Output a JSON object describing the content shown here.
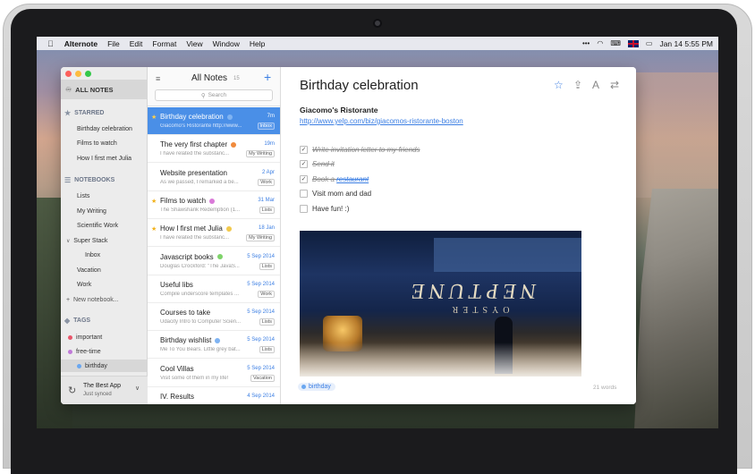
{
  "menubar": {
    "apple": "",
    "app_name": "Alternote",
    "menus": [
      "File",
      "Edit",
      "Format",
      "View",
      "Window",
      "Help"
    ],
    "date_time": "Jan 14  5:55 PM"
  },
  "sidebar": {
    "all_notes": "ALL NOTES",
    "starred_header": "STARRED",
    "starred": [
      "Birthday celebration",
      "Films to watch",
      "How I first met Julia"
    ],
    "notebooks_header": "NOTEBOOKS",
    "notebooks": [
      "Lists",
      "My Writing",
      "Scientific Work",
      "Super Stack"
    ],
    "stack_children": [
      "Inbox"
    ],
    "notebooks_after": [
      "Vacation",
      "Work"
    ],
    "new_notebook": "New notebook...",
    "tags_header": "TAGS",
    "tags": [
      {
        "name": "important",
        "color": "#e8566b"
      },
      {
        "name": "free-time",
        "color": "#c07ad8"
      },
      {
        "name": "birthday",
        "color": "#6aa7f0"
      }
    ],
    "sync": {
      "title": "The Best App",
      "subtitle": "Just synced"
    }
  },
  "notelist": {
    "title": "All Notes",
    "count": "15",
    "search_placeholder": "Search",
    "notes": [
      {
        "title": "Birthday celebration",
        "starred": true,
        "dot": "#7fb3f2",
        "date": "7m",
        "snippet": "Giacomo's Ristorante http://www...",
        "notebook": "Inbox",
        "selected": true
      },
      {
        "title": "The very first chapter",
        "starred": false,
        "dot": "#f08a3c",
        "date": "19m",
        "snippet": "I have related the substanc...",
        "notebook": "My Writing",
        "selected": false
      },
      {
        "title": "Website presentation",
        "starred": false,
        "dot": "",
        "date": "2 Apr",
        "snippet": "As we passed, I remarked a be...",
        "notebook": "Work",
        "selected": false
      },
      {
        "title": "Films to watch",
        "starred": true,
        "dot": "#d97ad8",
        "date": "31 Mar",
        "snippet": "The Shawshank Redemption (1...",
        "notebook": "Lists",
        "selected": false
      },
      {
        "title": "How I first met Julia",
        "starred": true,
        "dot": "#f2c94c",
        "date": "18 Jan",
        "snippet": "I have related the substanc...",
        "notebook": "My Writing",
        "selected": false
      },
      {
        "title": "Javascript books",
        "starred": false,
        "dot": "#7ed36a",
        "date": "5 Sep 2014",
        "snippet": "Douglas Crockford: \"The JavaS...",
        "notebook": "Lists",
        "selected": false
      },
      {
        "title": "Useful libs",
        "starred": false,
        "dot": "",
        "date": "5 Sep 2014",
        "snippet": "Compile underscore templates ...",
        "notebook": "Work",
        "selected": false
      },
      {
        "title": "Courses to take",
        "starred": false,
        "dot": "",
        "date": "5 Sep 2014",
        "snippet": "Udacity Intro to Computer Scien...",
        "notebook": "Lists",
        "selected": false
      },
      {
        "title": "Birthday wishlist",
        "starred": false,
        "dot": "#7fb3f2",
        "date": "5 Sep 2014",
        "snippet": "Me To You Bears. Little grey bat...",
        "notebook": "Lists",
        "selected": false
      },
      {
        "title": "Cool Villas",
        "starred": false,
        "dot": "",
        "date": "5 Sep 2014",
        "snippet": "Visit some of them in my life!",
        "notebook": "Vacation",
        "selected": false
      },
      {
        "title": "IV. Results",
        "starred": false,
        "dot": "",
        "date": "4 Sep 2014",
        "snippet": "",
        "notebook": "",
        "selected": false
      }
    ]
  },
  "editor": {
    "title": "Birthday celebration",
    "restaurant_name": "Giacomo's Ristorante",
    "restaurant_url": "http://www.yelp.com/biz/giacomos-ristorante-boston",
    "todos": [
      {
        "text": "Write invitation letter to my friends",
        "done": true
      },
      {
        "text": "Send it",
        "done": true
      },
      {
        "text": "Book a ",
        "link": "restaurant",
        "done": true
      },
      {
        "text": "Visit mom and dad",
        "done": false
      },
      {
        "text": "Have fun! :)",
        "done": false
      }
    ],
    "image": {
      "sign_text": "NEPTUNE",
      "sign_sub": "OYSTER"
    },
    "tag": "birthday",
    "word_count": "21 words"
  },
  "colors": {
    "accent": "#3b7ee3",
    "selection": "#4a8fe7"
  }
}
